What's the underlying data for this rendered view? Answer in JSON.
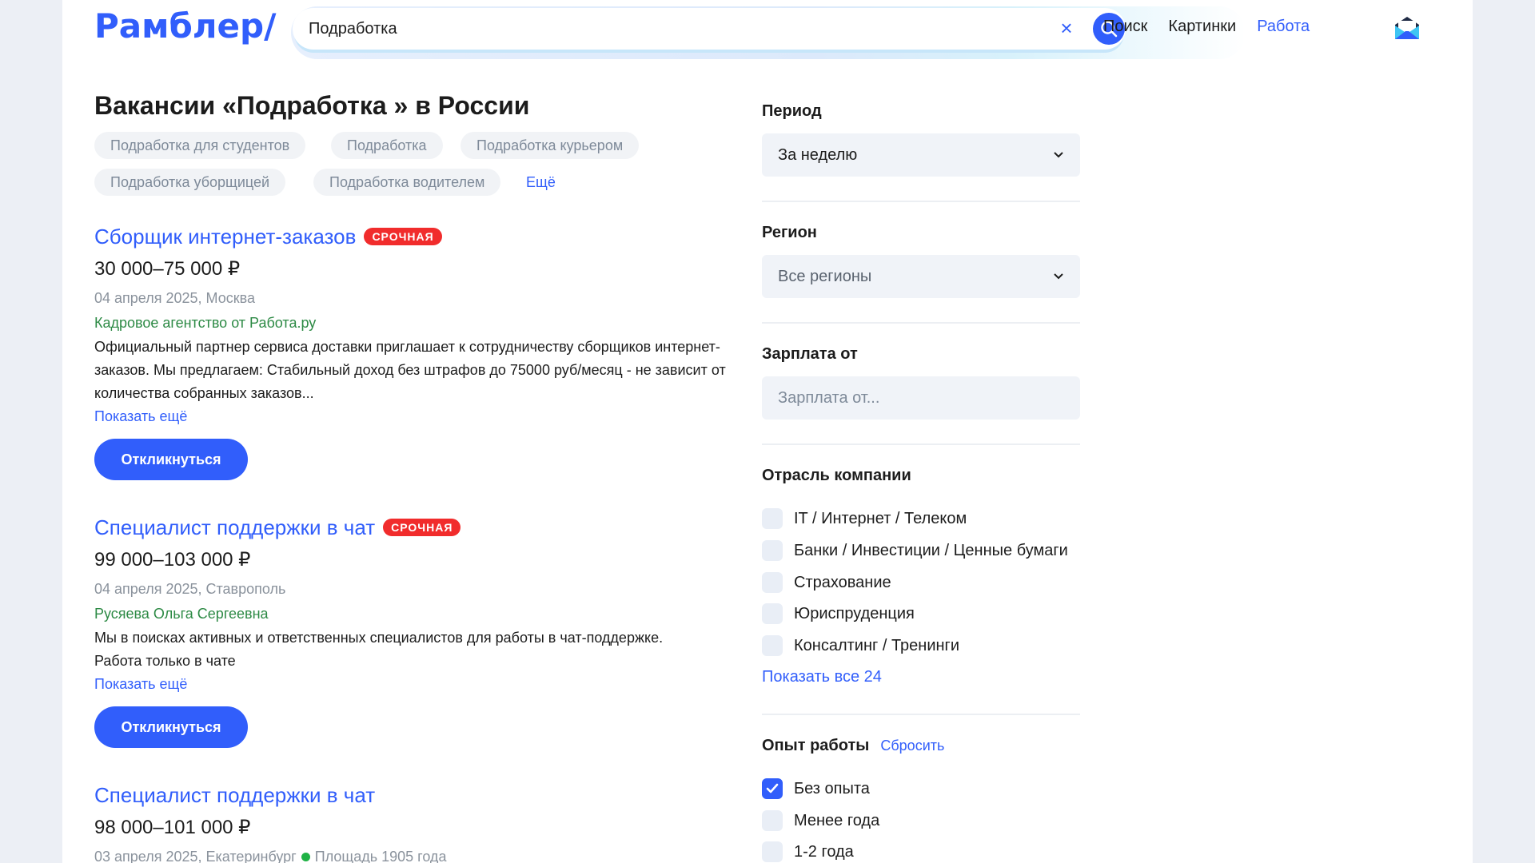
{
  "header": {
    "logo": "Рамблер/",
    "search": {
      "value": "Подработка",
      "placeholder": ""
    },
    "nav": [
      {
        "label": "Поиск",
        "active": false
      },
      {
        "label": "Картинки",
        "active": false
      },
      {
        "label": "Работа",
        "active": true
      }
    ]
  },
  "main": {
    "title": "Вакансии «Подработка » в России",
    "chips": [
      "Подработка для студентов",
      "Подработка",
      "Подработка курьером",
      "Подработка уборщицей",
      "Подработка водителем"
    ],
    "chips_more": "Ещё",
    "vacancies": [
      {
        "title": "Сборщик интернет-заказов",
        "badge": "СРОЧНАЯ",
        "salary": "30 000–75 000 ₽",
        "meta": "04 апреля 2025, Москва",
        "company": "Кадровое агентство от Работа.ру",
        "description": "Официальный партнер сервиса доставки приглашает к сотрудничеству сборщиков интернет-заказов. Мы предлагаем: Стабильный доход без штрафов до 75000 руб/месяц - не зависит от количества собранных заказов...",
        "more": "Показать ещё",
        "button": "Откликнуться"
      },
      {
        "title": "Специалист поддержки в чат",
        "badge": "СРОЧНАЯ",
        "salary": "99 000–103 000 ₽",
        "meta": "04 апреля 2025, Ставрополь",
        "company": "Русяева Ольга Сергеевна",
        "description": "Мы в поисках активных и ответственных специалистов для работы в чат-поддержке. Работа только в чате",
        "more": "Показать ещё",
        "button": "Откликнуться"
      },
      {
        "title": "Специалист поддержки в чат",
        "salary": "98 000–101 000 ₽",
        "meta": "03 апреля 2025, Екатеринбург",
        "metro": "Площадь 1905 года"
      }
    ]
  },
  "filters": {
    "period": {
      "label": "Период",
      "value": "За неделю"
    },
    "region": {
      "label": "Регион",
      "value": "Все регионы"
    },
    "salary": {
      "label": "Зарплата от",
      "placeholder": "Зарплата от..."
    },
    "industry": {
      "label": "Отрасль компании",
      "options": [
        {
          "label": "IT / Интернет / Телеком",
          "checked": false
        },
        {
          "label": "Банки / Инвестиции / Ценные бумаги",
          "checked": false
        },
        {
          "label": "Страхование",
          "checked": false
        },
        {
          "label": "Юриспруденция",
          "checked": false
        },
        {
          "label": "Консалтинг / Тренинги",
          "checked": false
        }
      ],
      "show_all": "Показать все 24"
    },
    "experience": {
      "label": "Опыт работы",
      "reset": "Сбросить",
      "options": [
        {
          "label": "Без опыта",
          "checked": true
        },
        {
          "label": "Менее года",
          "checked": false
        },
        {
          "label": "1-2 года",
          "checked": false
        }
      ]
    }
  },
  "colors": {
    "accent": "#315efb",
    "urgent": "#f12c2c",
    "company": "#2d8a45"
  }
}
